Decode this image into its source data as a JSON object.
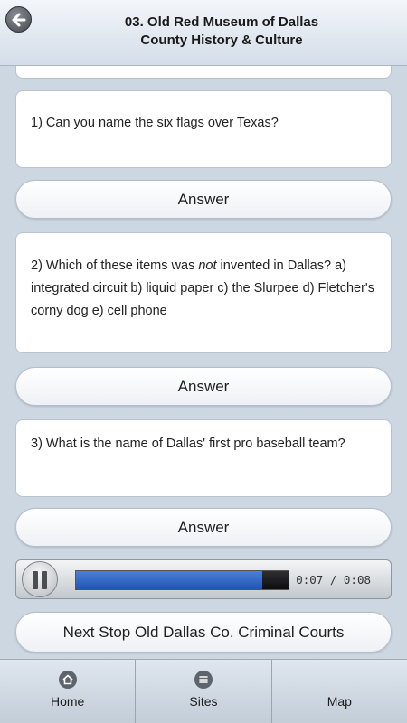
{
  "header": {
    "title_line1": "03. Old Red Museum of Dallas",
    "title_line2": "County History & Culture"
  },
  "questions": [
    {
      "text": "1)  Can you name the six flags over Texas?",
      "answer_label": "Answer"
    },
    {
      "text_before": "2)  Which of these items was ",
      "text_emphasis": "not",
      "text_after": " invented in Dallas?  a) integrated circuit  b) liquid paper c) the Slurpee d) Fletcher's corny dog  e) cell phone",
      "answer_label": "Answer"
    },
    {
      "text": "3) What is the name of Dallas' first pro baseball team?",
      "answer_label": "Answer"
    }
  ],
  "player": {
    "elapsed": "0:07",
    "separator": " / ",
    "duration": "0:08",
    "progress_fraction": 0.875
  },
  "next_stop": {
    "label": "Next Stop Old Dallas Co. Criminal Courts"
  },
  "tabbar": {
    "items": [
      {
        "label": "Home",
        "icon": "home-icon"
      },
      {
        "label": "Sites",
        "icon": "list-icon"
      },
      {
        "label": "Map",
        "icon": ""
      }
    ]
  }
}
